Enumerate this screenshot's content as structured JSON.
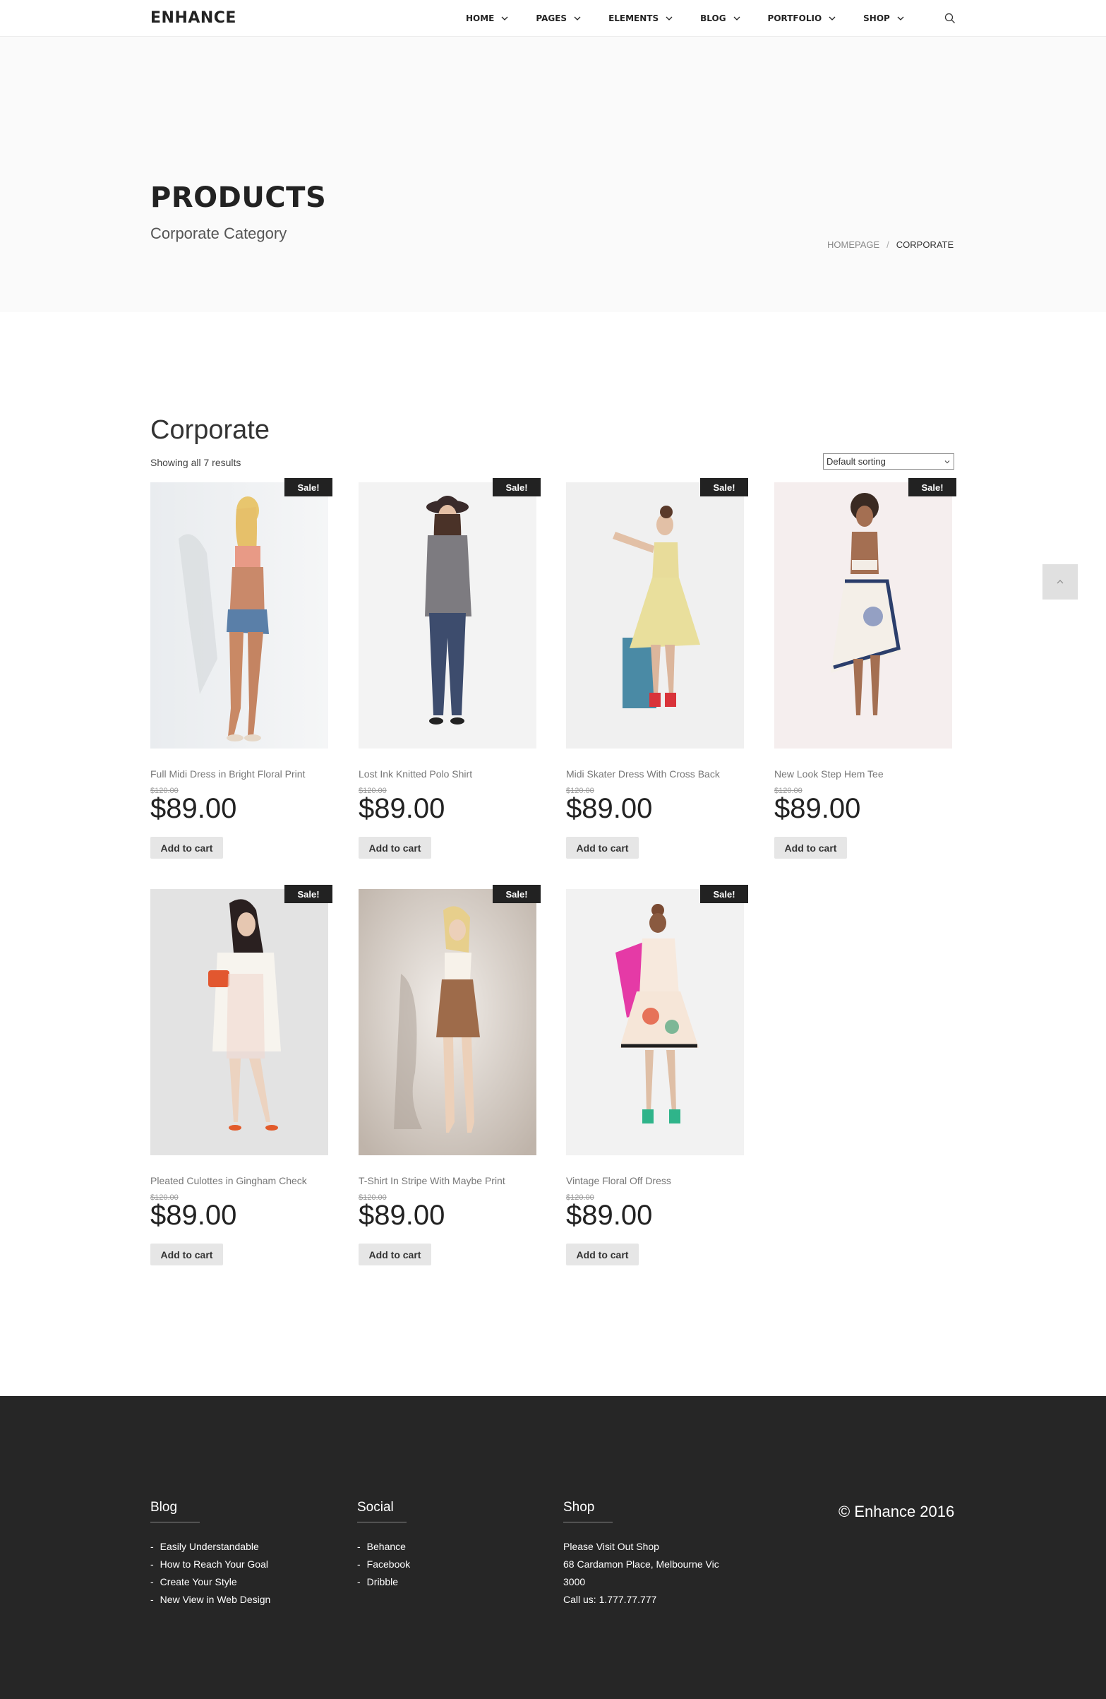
{
  "header": {
    "logo": "ENHANCE",
    "nav": [
      "HOME",
      "PAGES",
      "ELEMENTS",
      "BLOG",
      "PORTFOLIO",
      "SHOP"
    ]
  },
  "hero": {
    "title": "PRODUCTS",
    "subtitle": "Corporate Category",
    "breadcrumb": {
      "home": "HOMEPAGE",
      "separator": "/",
      "current": "CORPORATE"
    }
  },
  "shop": {
    "title": "Corporate",
    "result_count": "Showing all 7 results",
    "sorting": "Default sorting",
    "sale_label": "Sale!",
    "add_to_cart": "Add to cart",
    "products": [
      {
        "name": "Full Midi Dress in Bright Floral Print",
        "old_price": "$120.00",
        "price": "$89.00"
      },
      {
        "name": "Lost Ink Knitted Polo Shirt",
        "old_price": "$120.00",
        "price": "$89.00"
      },
      {
        "name": "Midi Skater Dress With Cross Back",
        "old_price": "$120.00",
        "price": "$89.00"
      },
      {
        "name": "New Look Step Hem Tee",
        "old_price": "$120.00",
        "price": "$89.00"
      },
      {
        "name": "Pleated Culottes in Gingham Check",
        "old_price": "$120.00",
        "price": "$89.00"
      },
      {
        "name": "T-Shirt In Stripe With Maybe Print",
        "old_price": "$120.00",
        "price": "$89.00"
      },
      {
        "name": "Vintage Floral Off Dress",
        "old_price": "$120.00",
        "price": "$89.00"
      }
    ]
  },
  "footer": {
    "blog": {
      "title": "Blog",
      "items": [
        "Easily Understandable",
        "How to Reach Your Goal",
        "Create Your Style",
        "New View in Web Design"
      ]
    },
    "social": {
      "title": "Social",
      "items": [
        "Behance",
        "Facebook",
        "Dribble"
      ]
    },
    "shop": {
      "title": "Shop",
      "lines": [
        "Please Visit Out Shop",
        "68 Cardamon Place, Melbourne Vic",
        "3000",
        "Call us: 1.777.77.777"
      ]
    },
    "copyright": "© Enhance 2016",
    "dash": "-"
  },
  "colors": {
    "footer_bg": "#262626",
    "hero_bg": "#fafafa",
    "sale_bg": "#222222",
    "button_bg": "#e6e6e6"
  },
  "icons": {
    "search": "search-icon",
    "chevron": "chevron-down-icon",
    "scroll_top": "chevron-up-icon"
  }
}
